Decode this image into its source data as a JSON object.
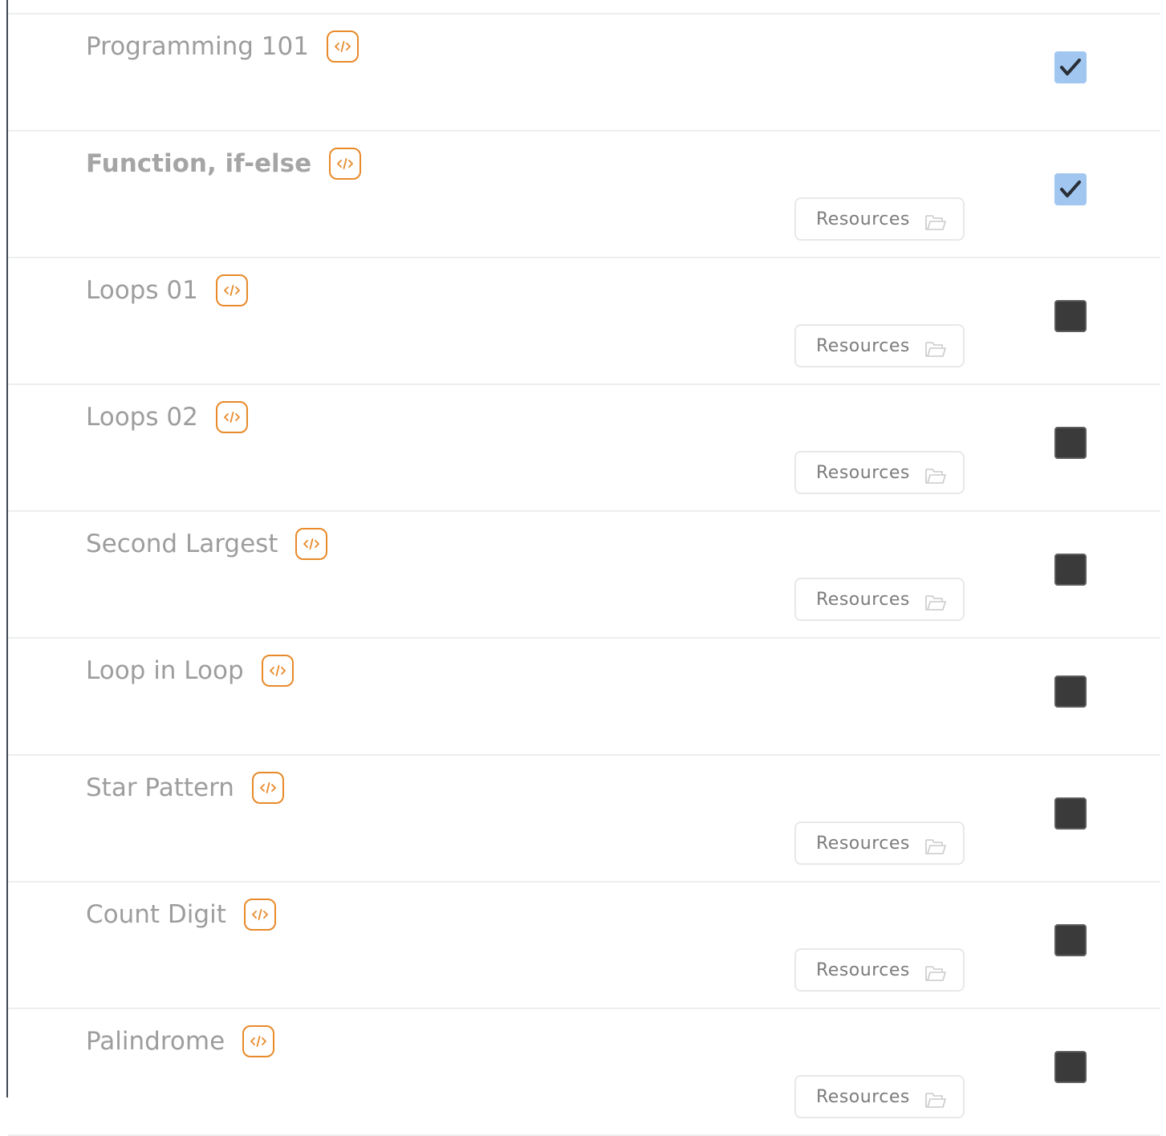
{
  "accent_color": "#e88a2a",
  "checked_color": "#a1c7f1",
  "lessons": [
    {
      "title": "Programming 101",
      "bold": false,
      "has_resources": false,
      "resources_label": "",
      "completed": true,
      "icon": "code-icon"
    },
    {
      "title": "Function, if-else",
      "bold": true,
      "has_resources": true,
      "resources_label": "Resources",
      "completed": true,
      "icon": "code-icon"
    },
    {
      "title": "Loops 01",
      "bold": false,
      "has_resources": true,
      "resources_label": "Resources",
      "completed": false,
      "icon": "code-icon"
    },
    {
      "title": "Loops 02",
      "bold": false,
      "has_resources": true,
      "resources_label": "Resources",
      "completed": false,
      "icon": "code-icon"
    },
    {
      "title": "Second Largest",
      "bold": false,
      "has_resources": true,
      "resources_label": "Resources",
      "completed": false,
      "icon": "code-icon"
    },
    {
      "title": "Loop in Loop",
      "bold": false,
      "has_resources": false,
      "resources_label": "",
      "completed": false,
      "icon": "code-icon"
    },
    {
      "title": "Star Pattern",
      "bold": false,
      "has_resources": true,
      "resources_label": "Resources",
      "completed": false,
      "icon": "code-icon"
    },
    {
      "title": "Count Digit",
      "bold": false,
      "has_resources": true,
      "resources_label": "Resources",
      "completed": false,
      "icon": "code-icon"
    },
    {
      "title": "Palindrome",
      "bold": false,
      "has_resources": true,
      "resources_label": "Resources",
      "completed": false,
      "icon": "code-icon"
    }
  ]
}
